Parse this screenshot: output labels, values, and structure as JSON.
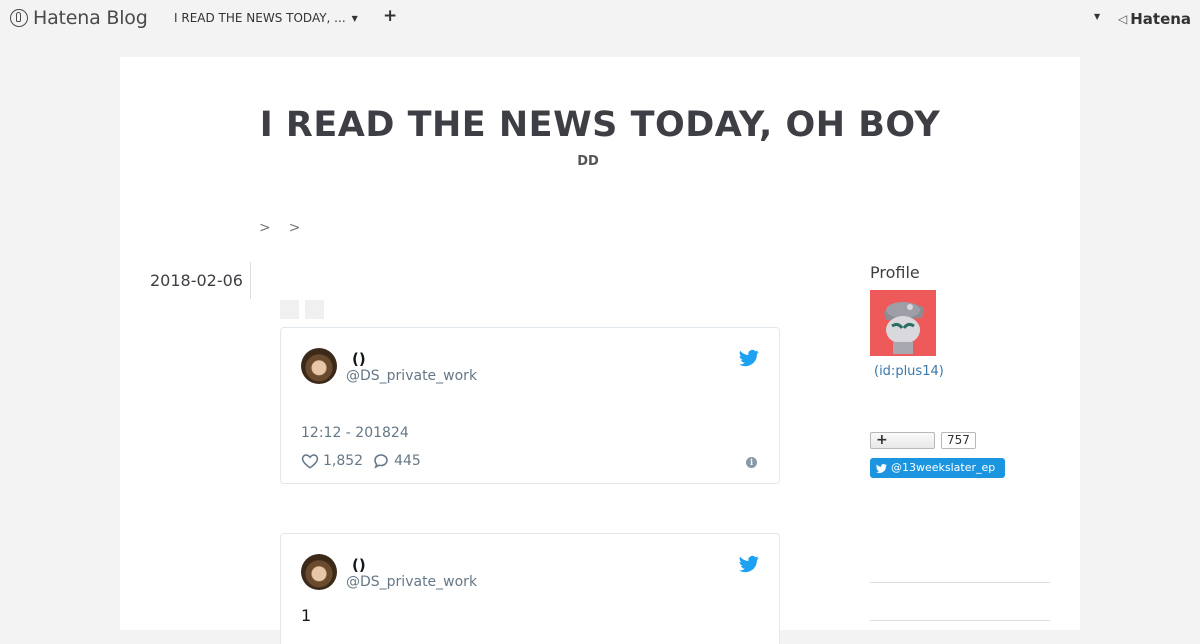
{
  "header": {
    "logo_text": "Hatena Blog",
    "blog_selector": "I READ THE NEWS TODAY, ...",
    "add_label": "+",
    "brand": "Hatena"
  },
  "blog": {
    "title": "I READ THE NEWS TODAY, OH BOY",
    "description": "DD"
  },
  "breadcrumb": {
    "sep1": ">",
    "sep2": ">"
  },
  "entry": {
    "date": "2018-02-06"
  },
  "tweets": [
    {
      "name": "()",
      "handle": "@DS_private_work",
      "time": "12:12 - 201824",
      "likes": "1,852",
      "replies": "445"
    },
    {
      "name": "()",
      "handle": "@DS_private_work",
      "text": "1"
    }
  ],
  "sidebar": {
    "profile_title": "Profile",
    "profile_id": "(id:plus14)",
    "follow_label": "+",
    "follow_count": "757",
    "twitter_follow": "@13weekslater_ep"
  },
  "colors": {
    "twitter_blue": "#1da1f2",
    "link": "#3b78a8",
    "avatar_bg": "#ee5a5a"
  }
}
